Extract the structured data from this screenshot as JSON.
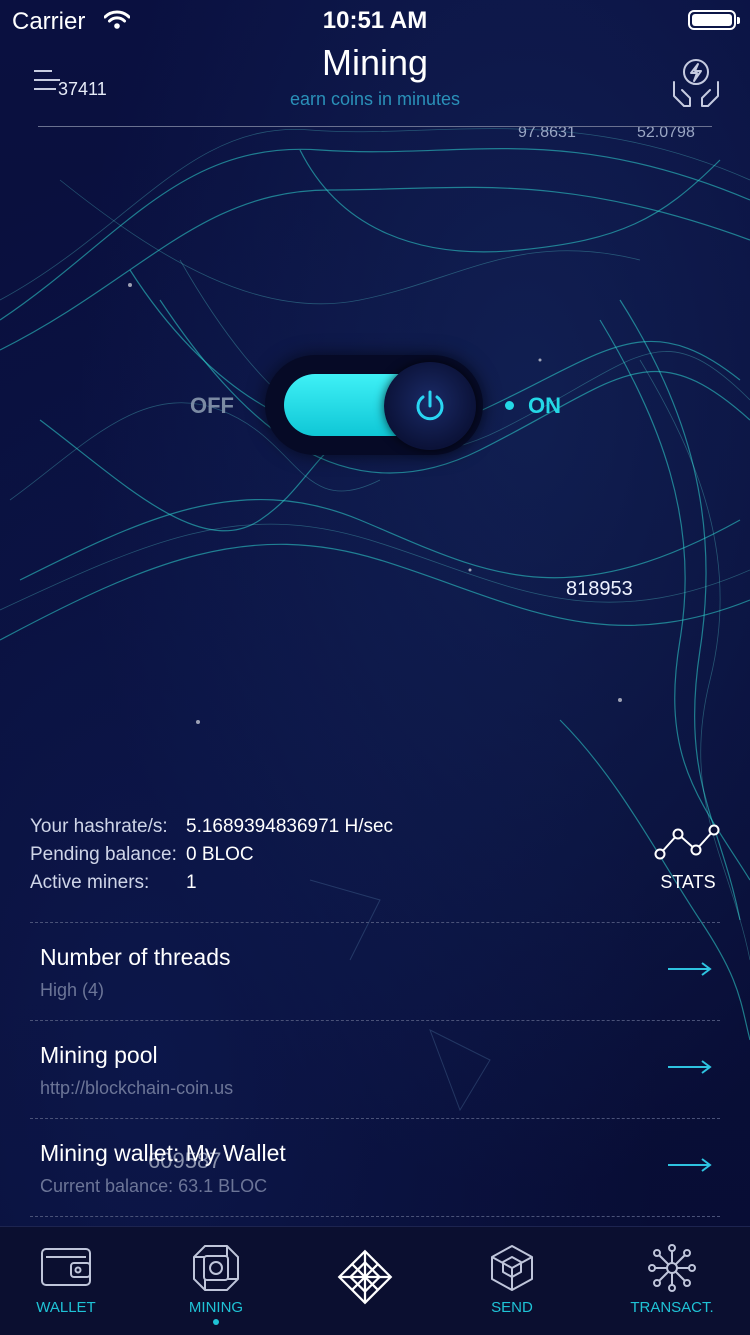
{
  "status_bar": {
    "carrier": "Carrier",
    "time": "10:51 AM"
  },
  "header": {
    "title": "Mining",
    "subtitle": "earn coins in minutes",
    "menu_icon": "menu-icon",
    "action_icon": "power-hands-icon"
  },
  "background_numbers": [
    "37411",
    "97.8631",
    "52.0798",
    "818953"
  ],
  "switch": {
    "off_label": "OFF",
    "on_label": "ON",
    "state": "on"
  },
  "stats": {
    "hashrate_label": "Your hashrate/s:",
    "hashrate_value": "5.1689394836971 H/sec",
    "pending_label": "Pending balance:",
    "pending_value": "0 BLOC",
    "miners_label": "Active miners:",
    "miners_value": "1",
    "stats_button": "STATS"
  },
  "settings": [
    {
      "title": "Number of threads",
      "subtitle": "High (4)"
    },
    {
      "title": "Mining pool",
      "subtitle": "http://blockchain-coin.us"
    },
    {
      "title": "Mining wallet: My Wallet",
      "subtitle": "Current balance: 63.1 BLOC"
    }
  ],
  "overlap_number": "609587",
  "tabbar": {
    "active": "mining",
    "tabs": [
      {
        "label": "WALLET",
        "icon": "wallet-icon"
      },
      {
        "label": "MINING",
        "icon": "mining-chip-icon"
      },
      {
        "label": "",
        "icon": "crystal-logo-icon"
      },
      {
        "label": "SEND",
        "icon": "send-cube-icon"
      },
      {
        "label": "TRANSACT.",
        "icon": "transactions-network-icon"
      }
    ]
  },
  "colors": {
    "accent": "#24d8e6",
    "background": "#0a0f36",
    "subtitle": "#2a90b8"
  }
}
